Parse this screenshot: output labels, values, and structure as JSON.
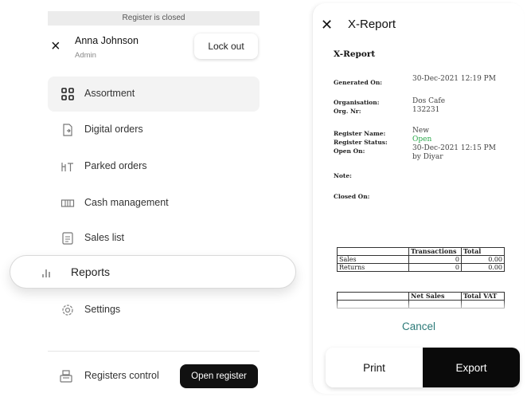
{
  "banner": {
    "text": "Register is closed"
  },
  "user": {
    "name": "Anna Johnson",
    "role": "Admin",
    "lockout_label": "Lock out"
  },
  "menu": {
    "items": [
      {
        "label": "Assortment",
        "icon": "grid-icon"
      },
      {
        "label": "Digital orders",
        "icon": "document-icon"
      },
      {
        "label": "Parked orders",
        "icon": "parked-icon"
      },
      {
        "label": "Cash management",
        "icon": "cash-icon"
      },
      {
        "label": "Sales list",
        "icon": "list-icon"
      },
      {
        "label": "Reports",
        "icon": "bar-chart-icon"
      },
      {
        "label": "Settings",
        "icon": "gear-icon"
      }
    ],
    "active": "Assortment",
    "highlighted": "Reports"
  },
  "bottom": {
    "label": "Registers control",
    "icon": "register-icon",
    "open_register_label": "Open register"
  },
  "report": {
    "header_title": "X-Report",
    "doc_title": "X-Report",
    "generated_on_label": "Generated On:",
    "generated_on_value": "30-Dec-2021 12:19 PM",
    "organisation_label": "Organisation:",
    "organisation_value": "Dos Cafe",
    "org_nr_label": "Org. Nr:",
    "org_nr_value": "132231",
    "register_name_label": "Register Name:",
    "register_name_value": "New",
    "register_status_label": "Register Status:",
    "register_status_value": "Open",
    "register_status_color": "#2aa84a",
    "open_on_label": "Open On:",
    "open_on_value": "30-Dec-2021 12:15 PM",
    "open_by_value": "by Diyar",
    "note_label": "Note:",
    "closed_on_label": "Closed On:",
    "table1": {
      "headers": [
        "",
        "Transactions",
        "Total"
      ],
      "rows": [
        [
          "Sales",
          "0",
          "0.00"
        ],
        [
          "Returns",
          "0",
          "0.00"
        ]
      ]
    },
    "table2": {
      "headers": [
        "",
        "Net Sales",
        "Total VAT"
      ]
    },
    "cancel_label": "Cancel",
    "print_label": "Print",
    "export_label": "Export"
  }
}
